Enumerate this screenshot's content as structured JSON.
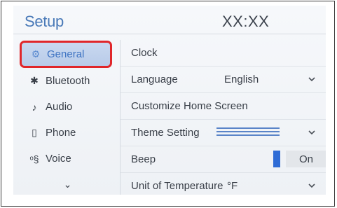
{
  "header": {
    "title": "Setup",
    "clock": "XX:XX"
  },
  "sidebar": {
    "items": [
      {
        "label": "General",
        "icon": "gear-icon",
        "glyph": "⚙",
        "selected": true
      },
      {
        "label": "Bluetooth",
        "icon": "bluetooth-icon",
        "glyph": "✱"
      },
      {
        "label": "Audio",
        "icon": "music-note-icon",
        "glyph": "♪"
      },
      {
        "label": "Phone",
        "icon": "phone-icon",
        "glyph": "▯"
      },
      {
        "label": "Voice",
        "icon": "voice-icon",
        "glyph": "ᵒ§"
      }
    ],
    "more_glyph": "⌄"
  },
  "settings": {
    "clock": {
      "label": "Clock"
    },
    "language": {
      "label": "Language",
      "value": "English"
    },
    "home_screen": {
      "label": "Customize Home Screen"
    },
    "theme": {
      "label": "Theme Setting"
    },
    "beep": {
      "label": "Beep",
      "value": "On"
    },
    "temperature": {
      "label": "Unit of Temperature",
      "value": "°F"
    }
  },
  "colors": {
    "accent": "#4a7ab8",
    "selection_outline": "#e0262a",
    "toggle_on": "#2f6cd6"
  }
}
